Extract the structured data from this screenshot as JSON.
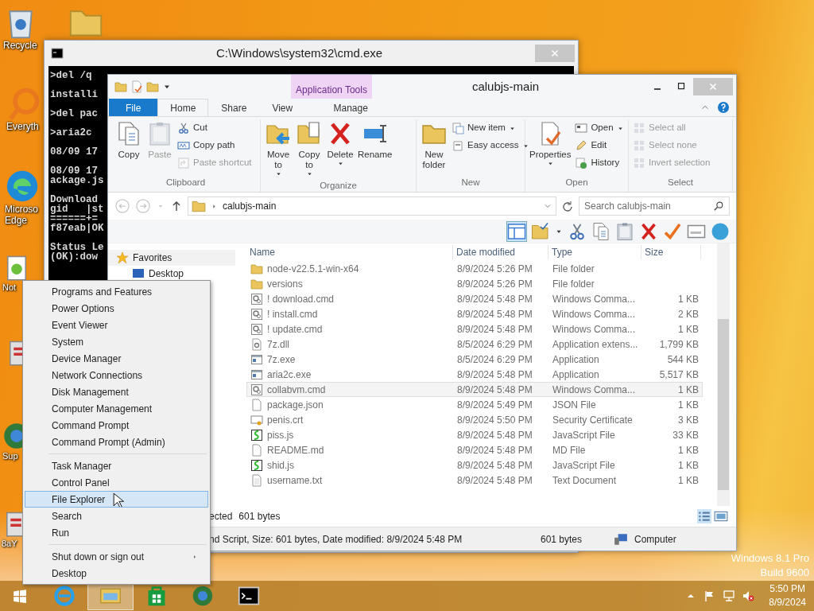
{
  "desktop_icons": [
    {
      "kind": "bin",
      "lines": [
        "Recycle"
      ]
    },
    {
      "kind": "folder"
    },
    {
      "kind": "search",
      "lines": [
        "Everyth"
      ]
    },
    {
      "kind": "edge",
      "lines": [
        "Microso",
        "Edge"
      ]
    },
    {
      "kind": "notepad",
      "lines": [
        "Not"
      ]
    },
    {
      "kind": "app"
    },
    {
      "kind": "globe",
      "lines": [
        "Sup"
      ]
    },
    {
      "kind": "app",
      "lines": [
        "8aY"
      ]
    }
  ],
  "cmd_window": {
    "title": "C:\\Windows\\system32\\cmd.exe",
    "output": [
      [
        ">del /q "
      ],
      [
        "installi"
      ],
      [
        ">del pac"
      ],
      [
        ">aria2c "
      ],
      [
        "08/09 17"
      ],
      [
        "08/09 17",
        "ackage.js"
      ],
      [
        "Download",
        "gid   |st",
        "======+=",
        "f87eab|OK"
      ],
      [
        "Status Le",
        "(OK):dow"
      ]
    ]
  },
  "explorer": {
    "title": "calubjs-main",
    "context_tab": "Application Tools",
    "tabs": [
      {
        "label": "File",
        "kind": "file",
        "selected": false
      },
      {
        "label": "Home",
        "kind": "tab",
        "selected": true
      },
      {
        "label": "Share",
        "kind": "tab",
        "selected": false
      },
      {
        "label": "View",
        "kind": "tab",
        "selected": false
      },
      {
        "label": "Manage",
        "kind": "context",
        "selected": false
      }
    ],
    "ribbon_groups": [
      {
        "label": "Clipboard",
        "large": [
          {
            "label": "Copy",
            "kind": "copy",
            "disabled": false,
            "dropdown": false
          },
          {
            "label": "Paste",
            "kind": "paste",
            "disabled": true,
            "dropdown": false
          }
        ],
        "small": [
          {
            "label": "Cut",
            "kind": "cut",
            "disabled": false,
            "dropdown": false
          },
          {
            "label": "Copy path",
            "kind": "path",
            "disabled": false,
            "dropdown": false
          },
          {
            "label": "Paste shortcut",
            "kind": "shortcut",
            "disabled": true,
            "dropdown": false
          }
        ]
      },
      {
        "label": "Organize",
        "large": [
          {
            "label": "Move to",
            "kind": "move",
            "disabled": false,
            "dropdown": true
          },
          {
            "label": "Copy to",
            "kind": "copyto",
            "disabled": false,
            "dropdown": true
          },
          {
            "label": "Delete",
            "kind": "delete",
            "disabled": false,
            "dropdown": true
          },
          {
            "label": "Rename",
            "kind": "rename",
            "disabled": false,
            "dropdown": false
          }
        ]
      },
      {
        "label": "New",
        "large": [
          {
            "label": "New folder",
            "kind": "folder",
            "disabled": false,
            "dropdown": false
          }
        ],
        "small": [
          {
            "label": "New item",
            "kind": "newitem",
            "disabled": false,
            "dropdown": true
          },
          {
            "label": "Easy access",
            "kind": "easy",
            "disabled": false,
            "dropdown": true
          }
        ]
      },
      {
        "label": "Open",
        "large": [
          {
            "label": "Properties",
            "kind": "props",
            "disabled": false,
            "dropdown": true
          }
        ],
        "small": [
          {
            "label": "Open",
            "kind": "open",
            "disabled": false,
            "dropdown": true
          },
          {
            "label": "Edit",
            "kind": "edit",
            "disabled": false,
            "dropdown": false
          },
          {
            "label": "History",
            "kind": "history",
            "disabled": false,
            "dropdown": false
          }
        ]
      },
      {
        "label": "Select",
        "small": [
          {
            "label": "Select all",
            "kind": "grid",
            "disabled": true,
            "dropdown": false
          },
          {
            "label": "Select none",
            "kind": "grid",
            "disabled": true,
            "dropdown": false
          },
          {
            "label": "Invert selection",
            "kind": "grid",
            "disabled": true,
            "dropdown": false
          }
        ]
      }
    ],
    "address": {
      "path": "calubjs-main",
      "search_placeholder": "Search calubjs-main"
    },
    "nav": [
      {
        "label": "Favorites",
        "kind": "star"
      },
      {
        "label": "Desktop",
        "kind": "desktop"
      }
    ],
    "columns": [
      "Name",
      "Date modified",
      "Type",
      "Size"
    ],
    "rows": [
      {
        "name": "node-v22.5.1-win-x64",
        "date": "8/9/2024 5:26 PM",
        "type": "File folder",
        "kind": "folder",
        "selected": false
      },
      {
        "name": "versions",
        "date": "8/9/2024 5:26 PM",
        "type": "File folder",
        "kind": "folder",
        "selected": false
      },
      {
        "name": "! download.cmd",
        "date": "8/9/2024 5:48 PM",
        "type": "Windows Comma...",
        "size": "1 KB",
        "kind": "cmd",
        "selected": false
      },
      {
        "name": "! install.cmd",
        "date": "8/9/2024 5:48 PM",
        "type": "Windows Comma...",
        "size": "2 KB",
        "kind": "cmd",
        "selected": false
      },
      {
        "name": "! update.cmd",
        "date": "8/9/2024 5:48 PM",
        "type": "Windows Comma...",
        "size": "1 KB",
        "kind": "cmd",
        "selected": false
      },
      {
        "name": "7z.dll",
        "date": "8/5/2024 6:29 PM",
        "type": "Application extens...",
        "size": "1,799 KB",
        "kind": "dll",
        "selected": false
      },
      {
        "name": "7z.exe",
        "date": "8/5/2024 6:29 PM",
        "type": "Application",
        "size": "544 KB",
        "kind": "exe",
        "selected": false
      },
      {
        "name": "aria2c.exe",
        "date": "8/9/2024 5:48 PM",
        "type": "Application",
        "size": "5,517 KB",
        "kind": "exe",
        "selected": false
      },
      {
        "name": "collabvm.cmd",
        "date": "8/9/2024 5:48 PM",
        "type": "Windows Comma...",
        "size": "1 KB",
        "kind": "cmd",
        "selected": true
      },
      {
        "name": "package.json",
        "date": "8/9/2024 5:49 PM",
        "type": "JSON File",
        "size": "1 KB",
        "kind": "blank",
        "selected": false
      },
      {
        "name": "penis.crt",
        "date": "8/9/2024 5:50 PM",
        "type": "Security Certificate",
        "size": "3 KB",
        "kind": "cert",
        "selected": false
      },
      {
        "name": "piss.js",
        "date": "8/9/2024 5:48 PM",
        "type": "JavaScript File",
        "size": "33 KB",
        "kind": "js",
        "selected": false
      },
      {
        "name": "README.md",
        "date": "8/9/2024 5:48 PM",
        "type": "MD File",
        "size": "1 KB",
        "kind": "blank",
        "selected": false
      },
      {
        "name": "shid.js",
        "date": "8/9/2024 5:48 PM",
        "type": "JavaScript File",
        "size": "1 KB",
        "kind": "js",
        "selected": false
      },
      {
        "name": "username.txt",
        "date": "8/9/2024 5:48 PM",
        "type": "Text Document",
        "size": "1 KB",
        "kind": "txt",
        "selected": false
      }
    ],
    "selection_status": "ected",
    "selection_size": "601 bytes",
    "status": {
      "details": "nd Script, Size: 601 bytes, Date modified: 8/9/2024 5:48 PM",
      "size": "601 bytes",
      "location": "Computer"
    }
  },
  "menu": [
    [
      {
        "label": "Programs and Features",
        "selected": false,
        "submenu": false
      },
      {
        "label": "Power Options",
        "selected": false,
        "submenu": false
      },
      {
        "label": "Event Viewer",
        "selected": false,
        "submenu": false
      },
      {
        "label": "System",
        "selected": false,
        "submenu": false
      },
      {
        "label": "Device Manager",
        "selected": false,
        "submenu": false
      },
      {
        "label": "Network Connections",
        "selected": false,
        "submenu": false
      },
      {
        "label": "Disk Management",
        "selected": false,
        "submenu": false
      },
      {
        "label": "Computer Management",
        "selected": false,
        "submenu": false
      },
      {
        "label": "Command Prompt",
        "selected": false,
        "submenu": false
      },
      {
        "label": "Command Prompt (Admin)",
        "selected": false,
        "submenu": false
      }
    ],
    [
      {
        "label": "Task Manager",
        "selected": false,
        "submenu": false
      },
      {
        "label": "Control Panel",
        "selected": false,
        "submenu": false
      },
      {
        "label": "File Explorer",
        "selected": true,
        "submenu": false
      },
      {
        "label": "Search",
        "selected": false,
        "submenu": false
      },
      {
        "label": "Run",
        "selected": false,
        "submenu": false
      }
    ],
    [
      {
        "label": "Shut down or sign out",
        "selected": false,
        "submenu": true
      },
      {
        "label": "Desktop",
        "selected": false,
        "submenu": false
      }
    ]
  ],
  "watermark": [
    "Windows 8.1 Pro",
    "Build 9600"
  ],
  "taskbar": {
    "items": [
      {
        "kind": "ie",
        "active": false
      },
      {
        "kind": "explorer",
        "active": true
      },
      {
        "kind": "store",
        "active": false
      },
      {
        "kind": "globe",
        "active": false
      },
      {
        "kind": "terminal",
        "active": false
      }
    ],
    "time": "5:50 PM",
    "date": "8/9/2024"
  }
}
